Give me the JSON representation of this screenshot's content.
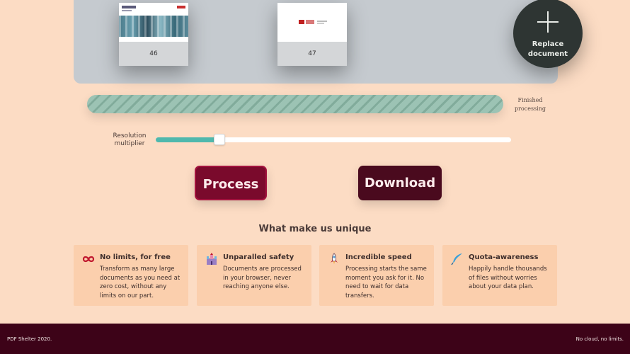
{
  "preview": {
    "pages": [
      {
        "number": "46"
      },
      {
        "number": "47"
      }
    ],
    "replace_label_line1": "Replace",
    "replace_label_line2": "document"
  },
  "progress": {
    "status_line1": "Finished",
    "status_line2": "processing",
    "value": 1.0,
    "fill_color": "#9cc3b4"
  },
  "slider": {
    "label_line1": "Resolution",
    "label_line2": "multiplier",
    "value_fraction": 0.18,
    "fill_color": "#4fb8ad"
  },
  "actions": {
    "process_label": "Process",
    "download_label": "Download",
    "process_color": "#7a0a2c",
    "download_color": "#4a0a1e"
  },
  "features": {
    "title": "What make us unique",
    "cards": [
      {
        "icon": "infinity-icon",
        "title": "No limits, for free",
        "body": "Transform as many large documents as you need at zero cost, without any limits on our part."
      },
      {
        "icon": "castle-icon",
        "title": "Unparalled safety",
        "body": "Documents are processed in your browser, never reaching anyone else."
      },
      {
        "icon": "rocket-icon",
        "title": "Incredible speed",
        "body": "Processing starts the same moment you ask for it. No need to wait for data transfers."
      },
      {
        "icon": "feather-icon",
        "title": "Quota-awareness",
        "body": "Happily handle thousands of files without worries about your data plan."
      }
    ]
  },
  "footer": {
    "left": "PDF Shelter 2020.",
    "right": "No cloud, no limits."
  },
  "colors": {
    "background": "#fcdcc4",
    "footer": "#3d0318",
    "card": "#fbcfad"
  }
}
